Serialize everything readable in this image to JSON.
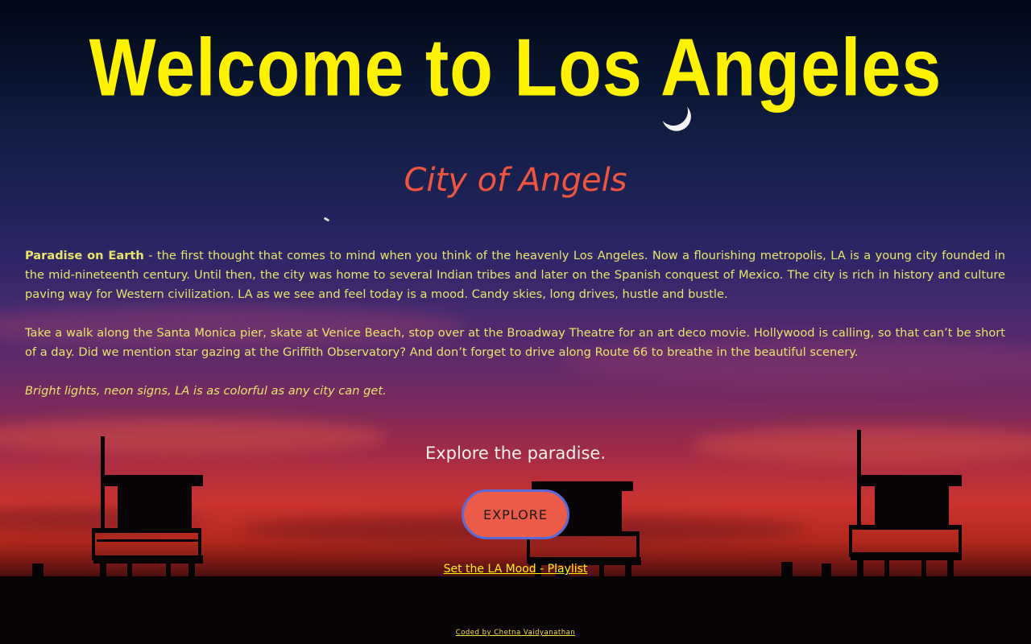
{
  "hero": {
    "title": "Welcome to Los Angeles",
    "subtitle": "City of Angels"
  },
  "intro": {
    "lead": "Paradise on Earth",
    "paragraph1": " - the first thought that comes to mind when you think of the heavenly Los Angeles. Now a flourishing metropolis, LA is a young city founded in the mid-nineteenth century. Until then, the city was home to several Indian tribes and later on the Spanish conquest of Mexico. The city is rich in history and culture paving way for Western civilization. LA as we see and feel today is a mood. Candy skies, long drives, hustle and bustle.",
    "paragraph2": "Take a walk along the Santa Monica pier, skate at Venice Beach, stop over at the Broadway Theatre for an art deco movie. Hollywood is calling, so that can’t be short of a day. Did we mention star gazing at the Griffith Observatory? And don’t forget to drive along Route 66 to breathe in the beautiful scenery.",
    "tagline": "Bright lights, neon signs, LA is as colorful as any city can get."
  },
  "cta": {
    "heading": "Explore the paradise.",
    "button_label": "EXPLORE",
    "playlist_link": "Set the LA Mood - Playlist"
  },
  "footer": {
    "credit": "Coded by Chetna Vaidyanathan"
  },
  "colors": {
    "title": "#fff200",
    "subtitle": "#f0563f",
    "body_text": "#e9e56a",
    "button_fill": "#ec5a4a",
    "button_border": "#5b6ad6",
    "link": "#fff200"
  },
  "icons": {
    "moon": "crescent-moon-icon",
    "bird": "bird-icon"
  }
}
